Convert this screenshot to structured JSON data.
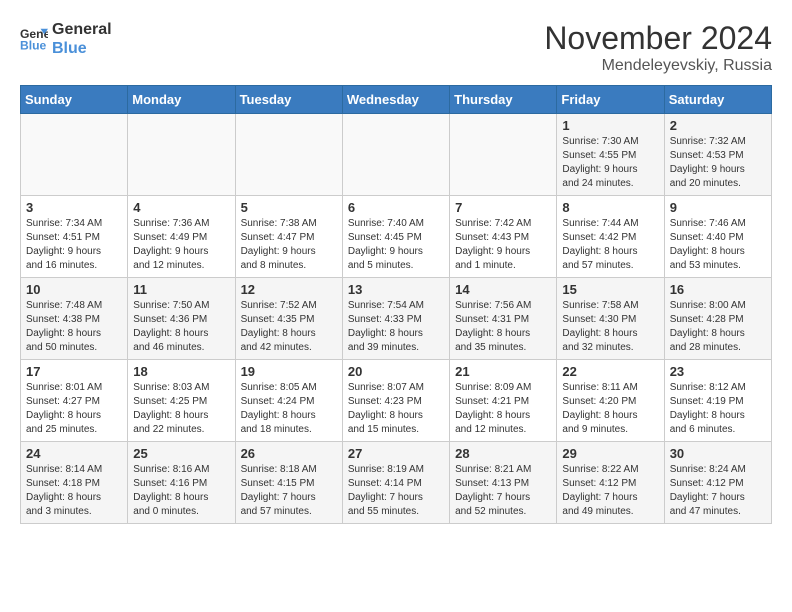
{
  "logo": {
    "line1": "General",
    "line2": "Blue"
  },
  "title": "November 2024",
  "subtitle": "Mendeleyevskiy, Russia",
  "headers": [
    "Sunday",
    "Monday",
    "Tuesday",
    "Wednesday",
    "Thursday",
    "Friday",
    "Saturday"
  ],
  "weeks": [
    [
      {
        "day": "",
        "info": ""
      },
      {
        "day": "",
        "info": ""
      },
      {
        "day": "",
        "info": ""
      },
      {
        "day": "",
        "info": ""
      },
      {
        "day": "",
        "info": ""
      },
      {
        "day": "1",
        "info": "Sunrise: 7:30 AM\nSunset: 4:55 PM\nDaylight: 9 hours\nand 24 minutes."
      },
      {
        "day": "2",
        "info": "Sunrise: 7:32 AM\nSunset: 4:53 PM\nDaylight: 9 hours\nand 20 minutes."
      }
    ],
    [
      {
        "day": "3",
        "info": "Sunrise: 7:34 AM\nSunset: 4:51 PM\nDaylight: 9 hours\nand 16 minutes."
      },
      {
        "day": "4",
        "info": "Sunrise: 7:36 AM\nSunset: 4:49 PM\nDaylight: 9 hours\nand 12 minutes."
      },
      {
        "day": "5",
        "info": "Sunrise: 7:38 AM\nSunset: 4:47 PM\nDaylight: 9 hours\nand 8 minutes."
      },
      {
        "day": "6",
        "info": "Sunrise: 7:40 AM\nSunset: 4:45 PM\nDaylight: 9 hours\nand 5 minutes."
      },
      {
        "day": "7",
        "info": "Sunrise: 7:42 AM\nSunset: 4:43 PM\nDaylight: 9 hours\nand 1 minute."
      },
      {
        "day": "8",
        "info": "Sunrise: 7:44 AM\nSunset: 4:42 PM\nDaylight: 8 hours\nand 57 minutes."
      },
      {
        "day": "9",
        "info": "Sunrise: 7:46 AM\nSunset: 4:40 PM\nDaylight: 8 hours\nand 53 minutes."
      }
    ],
    [
      {
        "day": "10",
        "info": "Sunrise: 7:48 AM\nSunset: 4:38 PM\nDaylight: 8 hours\nand 50 minutes."
      },
      {
        "day": "11",
        "info": "Sunrise: 7:50 AM\nSunset: 4:36 PM\nDaylight: 8 hours\nand 46 minutes."
      },
      {
        "day": "12",
        "info": "Sunrise: 7:52 AM\nSunset: 4:35 PM\nDaylight: 8 hours\nand 42 minutes."
      },
      {
        "day": "13",
        "info": "Sunrise: 7:54 AM\nSunset: 4:33 PM\nDaylight: 8 hours\nand 39 minutes."
      },
      {
        "day": "14",
        "info": "Sunrise: 7:56 AM\nSunset: 4:31 PM\nDaylight: 8 hours\nand 35 minutes."
      },
      {
        "day": "15",
        "info": "Sunrise: 7:58 AM\nSunset: 4:30 PM\nDaylight: 8 hours\nand 32 minutes."
      },
      {
        "day": "16",
        "info": "Sunrise: 8:00 AM\nSunset: 4:28 PM\nDaylight: 8 hours\nand 28 minutes."
      }
    ],
    [
      {
        "day": "17",
        "info": "Sunrise: 8:01 AM\nSunset: 4:27 PM\nDaylight: 8 hours\nand 25 minutes."
      },
      {
        "day": "18",
        "info": "Sunrise: 8:03 AM\nSunset: 4:25 PM\nDaylight: 8 hours\nand 22 minutes."
      },
      {
        "day": "19",
        "info": "Sunrise: 8:05 AM\nSunset: 4:24 PM\nDaylight: 8 hours\nand 18 minutes."
      },
      {
        "day": "20",
        "info": "Sunrise: 8:07 AM\nSunset: 4:23 PM\nDaylight: 8 hours\nand 15 minutes."
      },
      {
        "day": "21",
        "info": "Sunrise: 8:09 AM\nSunset: 4:21 PM\nDaylight: 8 hours\nand 12 minutes."
      },
      {
        "day": "22",
        "info": "Sunrise: 8:11 AM\nSunset: 4:20 PM\nDaylight: 8 hours\nand 9 minutes."
      },
      {
        "day": "23",
        "info": "Sunrise: 8:12 AM\nSunset: 4:19 PM\nDaylight: 8 hours\nand 6 minutes."
      }
    ],
    [
      {
        "day": "24",
        "info": "Sunrise: 8:14 AM\nSunset: 4:18 PM\nDaylight: 8 hours\nand 3 minutes."
      },
      {
        "day": "25",
        "info": "Sunrise: 8:16 AM\nSunset: 4:16 PM\nDaylight: 8 hours\nand 0 minutes."
      },
      {
        "day": "26",
        "info": "Sunrise: 8:18 AM\nSunset: 4:15 PM\nDaylight: 7 hours\nand 57 minutes."
      },
      {
        "day": "27",
        "info": "Sunrise: 8:19 AM\nSunset: 4:14 PM\nDaylight: 7 hours\nand 55 minutes."
      },
      {
        "day": "28",
        "info": "Sunrise: 8:21 AM\nSunset: 4:13 PM\nDaylight: 7 hours\nand 52 minutes."
      },
      {
        "day": "29",
        "info": "Sunrise: 8:22 AM\nSunset: 4:12 PM\nDaylight: 7 hours\nand 49 minutes."
      },
      {
        "day": "30",
        "info": "Sunrise: 8:24 AM\nSunset: 4:12 PM\nDaylight: 7 hours\nand 47 minutes."
      }
    ]
  ]
}
